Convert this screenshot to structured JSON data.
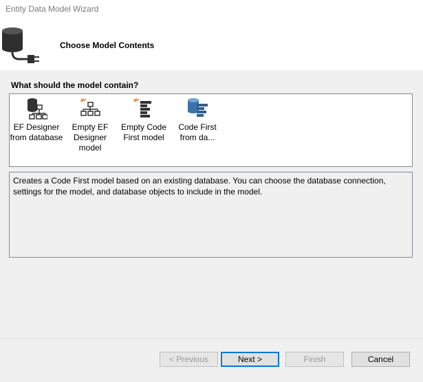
{
  "window": {
    "title": "Entity Data Model Wizard"
  },
  "header": {
    "title": "Choose Model Contents"
  },
  "question": "What should the model contain?",
  "choices": [
    {
      "label": "EF Designer from database",
      "icon": "database-hierarchy-icon"
    },
    {
      "label": "Empty EF Designer model",
      "icon": "empty-hierarchy-icon"
    },
    {
      "label": "Empty Code First model",
      "icon": "empty-code-first-icon"
    },
    {
      "label": "Code First from da...",
      "icon": "code-first-database-icon",
      "selected": true
    }
  ],
  "description": "Creates a Code First model based on an existing database. You can choose the database connection, settings for the model, and database objects to include in the model.",
  "buttons": {
    "previous": "< Previous",
    "next": "Next >",
    "finish": "Finish",
    "cancel": "Cancel"
  }
}
